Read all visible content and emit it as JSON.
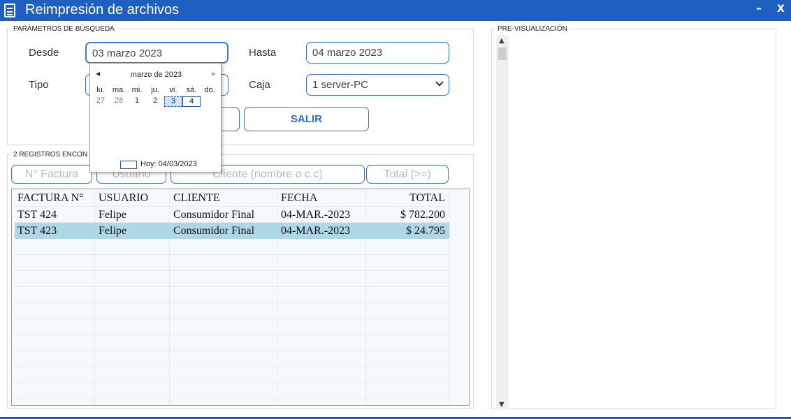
{
  "window": {
    "title": "Reimpresión de archivos",
    "minimize": "–",
    "close": "X"
  },
  "search": {
    "legend": "PARÁMETROS DE BÚSQUEDA",
    "desde_label": "Desde",
    "desde_value": "03 marzo 2023",
    "hasta_label": "Hasta",
    "hasta_value": "04 marzo 2023",
    "tipo_label": "Tipo",
    "caja_label": "Caja",
    "caja_value": "1 server-PC",
    "salir_label": "SALIR"
  },
  "results": {
    "legend": "2 REGISTROS ENCON",
    "filters": {
      "factura_placeholder": "N° Factura",
      "usuario_placeholder": "Usuario",
      "cliente_placeholder": "Cliente (nombre o c.c)",
      "total_placeholder": "Total (>=)"
    },
    "columns": [
      "FACTURA N°",
      "USUARIO",
      "CLIENTE",
      "FECHA",
      "TOTAL"
    ],
    "rows": [
      [
        "TST 424",
        "Felipe",
        "Consumidor Final",
        "04-MAR.-2023",
        "$ 782.200"
      ],
      [
        "TST 423",
        "Felipe",
        "Consumidor Final",
        "04-MAR.-2023",
        "$ 24.795"
      ]
    ],
    "selected_row": 1
  },
  "preview": {
    "legend": "PRE-VISUALIZACIÓN"
  },
  "calendar": {
    "month": "marzo de 2023",
    "day_names": [
      "lu.",
      "ma.",
      "mi.",
      "ju.",
      "vi.",
      "sá.",
      "do."
    ],
    "days": [
      "27",
      "28",
      "1",
      "2",
      "3",
      "4"
    ],
    "selected_day": "3",
    "today_day": "4",
    "today_label": "Hoy: 04/03/2023"
  },
  "colors": {
    "accent": "#1e5fbf",
    "selected_row": "#add8e6",
    "border": "#2f6fd0"
  }
}
